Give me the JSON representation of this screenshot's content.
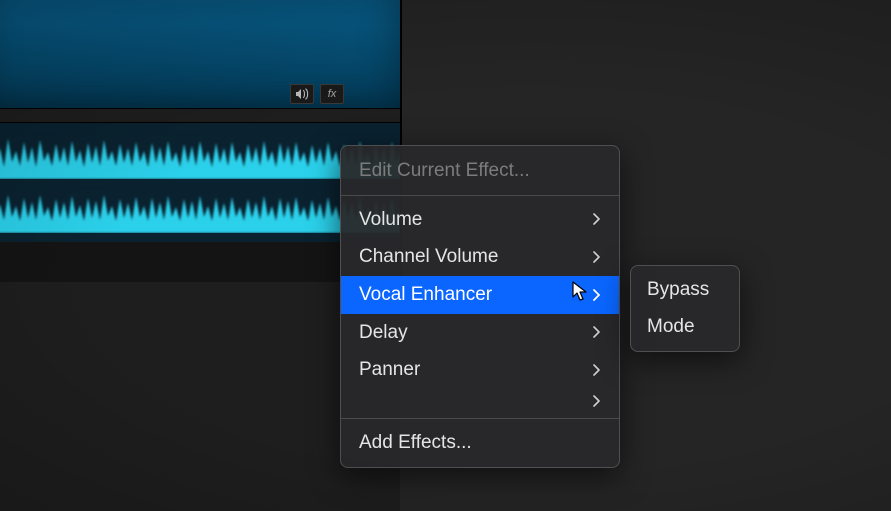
{
  "track": {
    "icons": {
      "speaker": "speaker-icon",
      "fx": "fx-icon",
      "fx_label": "fx"
    }
  },
  "menu": {
    "header": "Edit Current Effect...",
    "items": [
      {
        "label": "Volume",
        "has_submenu": true,
        "highlighted": false
      },
      {
        "label": "Channel Volume",
        "has_submenu": true,
        "highlighted": false
      },
      {
        "label": "Vocal Enhancer",
        "has_submenu": true,
        "highlighted": true
      },
      {
        "label": "Delay",
        "has_submenu": true,
        "highlighted": false
      },
      {
        "label": "Panner",
        "has_submenu": true,
        "highlighted": false
      }
    ],
    "footer": "Add Effects..."
  },
  "submenu": {
    "items": [
      {
        "label": "Bypass"
      },
      {
        "label": "Mode"
      }
    ]
  },
  "colors": {
    "highlight": "#0a66ff",
    "waveform": "#2fe3ff",
    "clip_bg": "#0a2230"
  }
}
